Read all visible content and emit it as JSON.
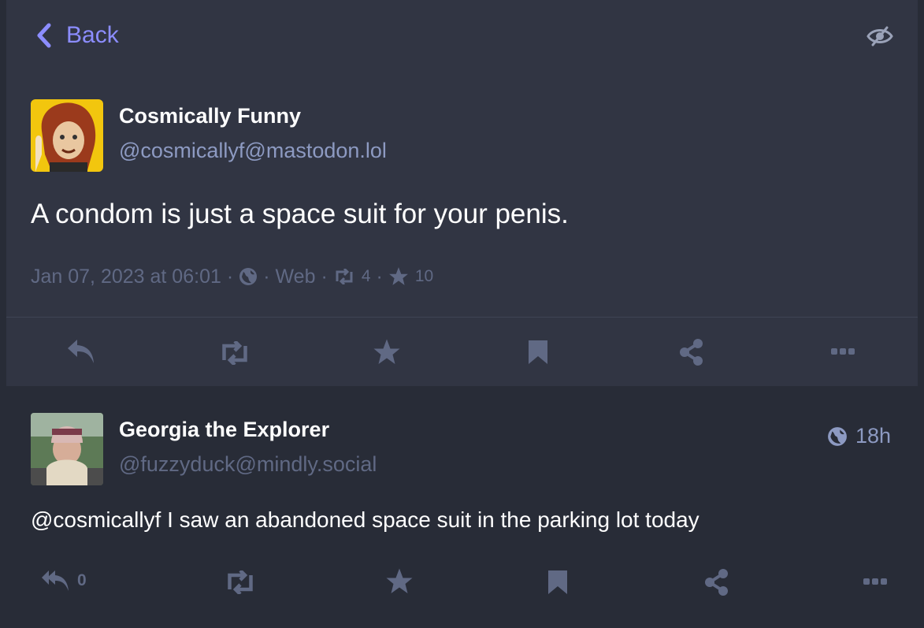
{
  "nav": {
    "back_label": "Back"
  },
  "status": {
    "display_name": "Cosmically Funny",
    "handle": "@cosmicallyf@mastodon.lol",
    "content": "A condom is just a space suit for your penis.",
    "date": "Jan 07, 2023 at 06:01",
    "visibility_icon": "globe-icon",
    "application": "Web",
    "boosts": "4",
    "favourites": "10"
  },
  "actions": [
    "reply-icon",
    "boost-icon",
    "star-icon",
    "bookmark-icon",
    "share-icon",
    "more-icon"
  ],
  "reply": {
    "display_name": "Georgia the Explorer",
    "handle": "@fuzzyduck@mindly.social",
    "time": "18h",
    "content": "@cosmicallyf I saw an abandoned space suit in the parking lot today",
    "replies_count": "0"
  },
  "colors": {
    "accent": "#8c8dff",
    "muted": "#606984",
    "handle": "#8d9ac2",
    "background": "#313543",
    "reply_background": "#282c37"
  }
}
